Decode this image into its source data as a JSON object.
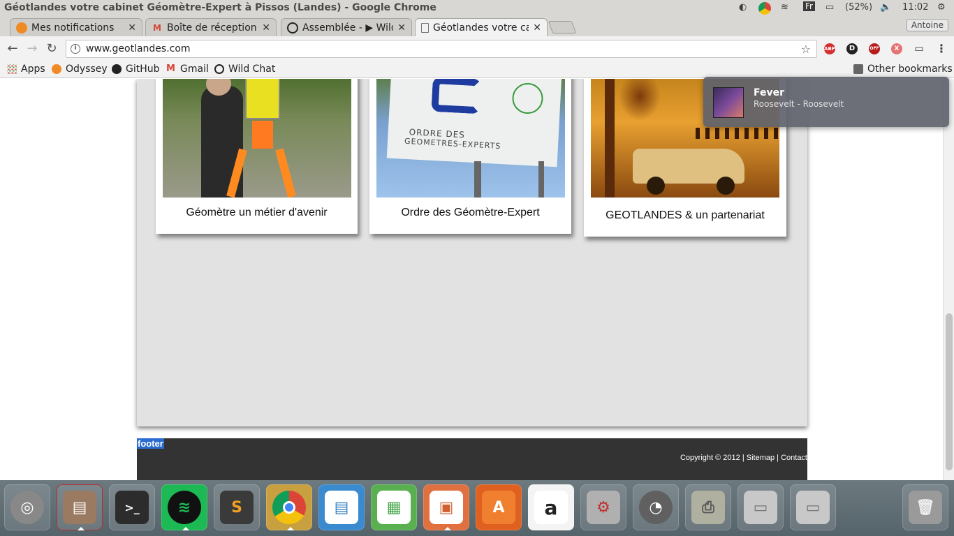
{
  "window": {
    "title": "Géotlandes votre cabinet Géomètre-Expert à Pissos (Landes) - Google Chrome",
    "battery": "(52%)",
    "clock": "11:02",
    "keyboard_layout": "Fr"
  },
  "tabs": [
    {
      "label": "Mes notifications",
      "icon": "odyssey-icon",
      "active": false
    },
    {
      "label": "Boîte de réception - a",
      "icon": "gmail-icon",
      "active": false
    },
    {
      "label": "Assemblée - ▶ Wild C",
      "icon": "wildchat-icon",
      "active": false
    },
    {
      "label": "Géotlandes votre cab",
      "icon": "page-icon",
      "active": true
    }
  ],
  "profile": {
    "name": "Antoine"
  },
  "omnibox": {
    "url": "www.geotlandes.com"
  },
  "extensions": [
    "ABP",
    "D",
    "OFF",
    "X"
  ],
  "bookmarks": {
    "items": [
      {
        "label": "Apps",
        "icon": "apps-grid-icon"
      },
      {
        "label": "Odyssey",
        "icon": "odyssey-icon"
      },
      {
        "label": "GitHub",
        "icon": "github-icon"
      },
      {
        "label": "Gmail",
        "icon": "gmail-icon"
      },
      {
        "label": "Wild Chat",
        "icon": "wildchat-icon"
      }
    ],
    "other": "Other bookmarks"
  },
  "page": {
    "cards": [
      {
        "caption": "Géomètre un métier d'avenir",
        "image": "surveyor-with-instrument-photo"
      },
      {
        "caption": "Ordre des Géomètre-Expert",
        "image": "ordre-des-geometres-experts-sign-photo"
      },
      {
        "caption": "GEOTLANDES & un partenariat",
        "image": "desert-rally-poster-photo"
      }
    ],
    "sign_text": {
      "line1": "ORDRE DES",
      "line2": "GEOMETRES-EXPERTS"
    },
    "footer": {
      "label": "footer",
      "copyright": "Copyright © 2012",
      "links": [
        "Sitemap",
        "Contact"
      ]
    }
  },
  "notification": {
    "title": "Fever",
    "body": "Roosevelt - Roosevelt"
  },
  "dock": {
    "apps": [
      {
        "name": "ubuntu-dash",
        "color": "#7c7c7c",
        "running": false
      },
      {
        "name": "files",
        "color": "#9a6a50",
        "running": true
      },
      {
        "name": "terminal",
        "color": "#2c2c2c",
        "running": false
      },
      {
        "name": "spotify",
        "color": "#1db954",
        "running": true
      },
      {
        "name": "sublime-text",
        "color": "#4a4a4a",
        "running": false
      },
      {
        "name": "chrome",
        "color": "#e8b030",
        "running": true
      },
      {
        "name": "libreoffice-writer",
        "color": "#2a7ac0",
        "running": false
      },
      {
        "name": "libreoffice-calc",
        "color": "#3aa040",
        "running": false
      },
      {
        "name": "libreoffice-impress",
        "color": "#d06030",
        "running": true
      },
      {
        "name": "software-center",
        "color": "#e06020",
        "running": false
      },
      {
        "name": "amazon",
        "color": "#f0f0f0",
        "running": false
      },
      {
        "name": "system-settings",
        "color": "#b0b0b0",
        "running": false
      },
      {
        "name": "disk-usage",
        "color": "#707070",
        "running": false
      },
      {
        "name": "printer",
        "color": "#a0a090",
        "running": false
      },
      {
        "name": "drive-1",
        "color": "#c0c0c0",
        "running": false
      },
      {
        "name": "drive-2",
        "color": "#c0c0c0",
        "running": false
      },
      {
        "name": "trash",
        "color": "#8a8a8a",
        "running": false
      }
    ]
  }
}
